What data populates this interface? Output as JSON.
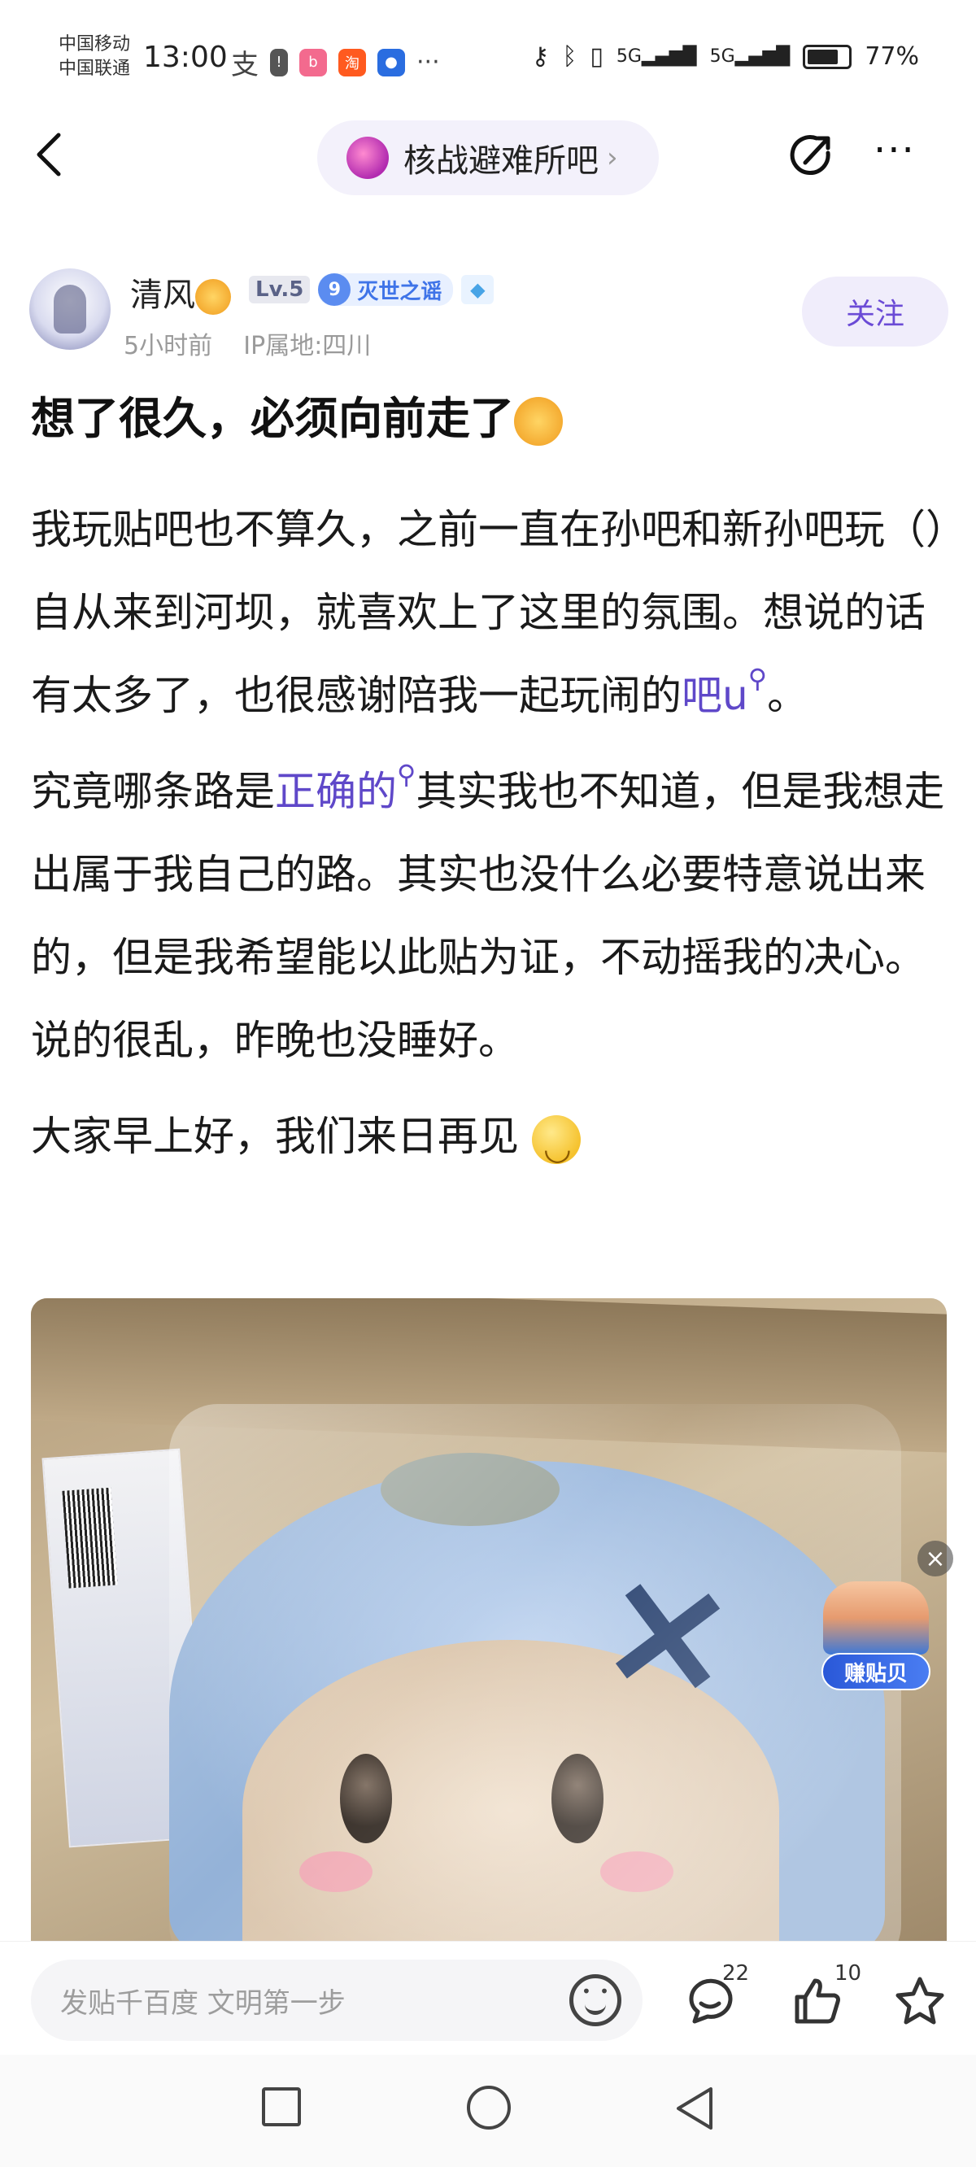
{
  "status_bar": {
    "carrier_1": "中国移动",
    "carrier_2": "中国联通",
    "time": "13:00",
    "battery_percent": "77%",
    "battery_level": 0.77,
    "signal_1": "5G",
    "signal_2": "5G"
  },
  "nav": {
    "forum_name": "核战避难所吧"
  },
  "author": {
    "name": "清风",
    "level": "Lv.5",
    "title_level": "9",
    "title": "灭世之谣",
    "meta_time": "5小时前",
    "meta_location": "IP属地:四川",
    "follow_label": "关注"
  },
  "post": {
    "title": "想了很久，必须向前走了",
    "paragraph_1_text": "我玩贴吧也不算久，之前一直在孙吧和新孙吧玩（）自从来到河坝，就喜欢上了这里的氛围。想说的话有太多了，也很感谢陪我一起玩闹的",
    "paragraph_1_link": "吧u",
    "paragraph_1_end": "。",
    "paragraph_2_start": "究竟哪条路是",
    "paragraph_2_link": "正确的",
    "paragraph_2_rest": "其实我也不知道，但是我想走出属于我自己的路。其实也没什么必要特意说出来的，但是我希望能以此贴为证，不动摇我的决心。说的很乱，昨晚也没睡好。",
    "paragraph_3": "大家早上好，我们来日再见"
  },
  "float_ad": {
    "label": "赚贴贝"
  },
  "bottom_bar": {
    "input_placeholder": "发贴千百度 文明第一步",
    "comment_count": "22",
    "like_count": "10"
  },
  "colors": {
    "accent": "#5f48c9",
    "follow_bg": "#f0edfb",
    "title_badge": "#3f74e8"
  }
}
